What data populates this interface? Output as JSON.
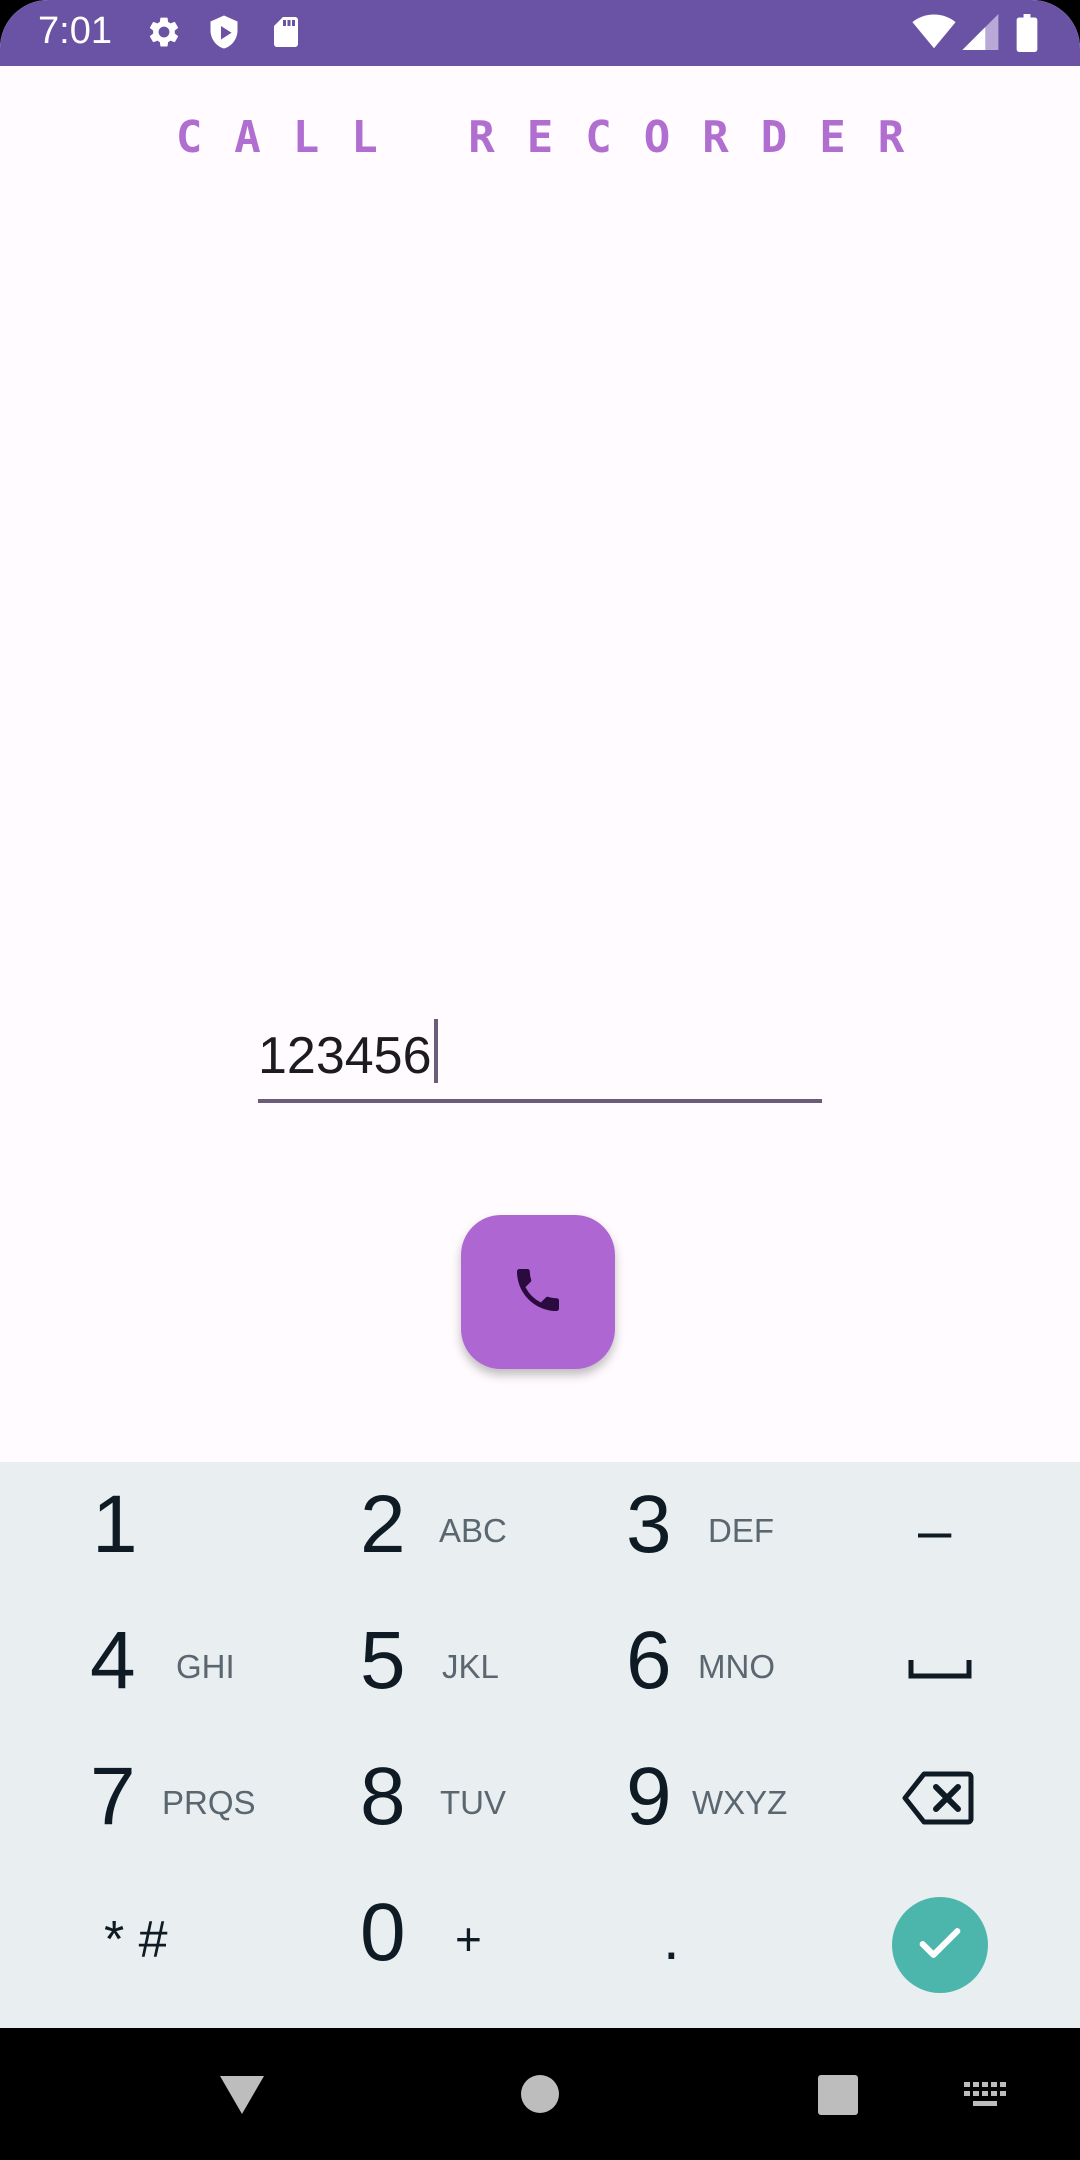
{
  "status_bar": {
    "time": "7:01",
    "icons": [
      "gear-icon",
      "shield-icon",
      "sd-card-icon",
      "wifi-icon",
      "signal-icon",
      "battery-icon"
    ],
    "color": "#6a52a4"
  },
  "app": {
    "title": "CALL RECORDER",
    "title_color": "#b06fd0"
  },
  "number_field": {
    "value": "123456"
  },
  "call_button": {
    "icon": "phone-icon",
    "color": "#ad66d2"
  },
  "keypad": {
    "keys": [
      {
        "digit": "1",
        "letters": ""
      },
      {
        "digit": "2",
        "letters": "ABC"
      },
      {
        "digit": "3",
        "letters": "DEF"
      },
      {
        "digit": "4",
        "letters": "GHI"
      },
      {
        "digit": "5",
        "letters": "JKL"
      },
      {
        "digit": "6",
        "letters": "MNO"
      },
      {
        "digit": "7",
        "letters": "PRQS"
      },
      {
        "digit": "8",
        "letters": "TUV"
      },
      {
        "digit": "9",
        "letters": "WXYZ"
      },
      {
        "digit": "0",
        "letters": "+"
      }
    ],
    "dash": "–",
    "star_hash": "* #",
    "period": ".",
    "space_icon": "space-icon",
    "backspace_icon": "backspace-icon",
    "done_icon": "check-icon",
    "done_color": "#4db6ac"
  },
  "nav_bar": {
    "icons": [
      "back-icon",
      "home-icon",
      "recents-icon",
      "keyboard-icon"
    ]
  }
}
